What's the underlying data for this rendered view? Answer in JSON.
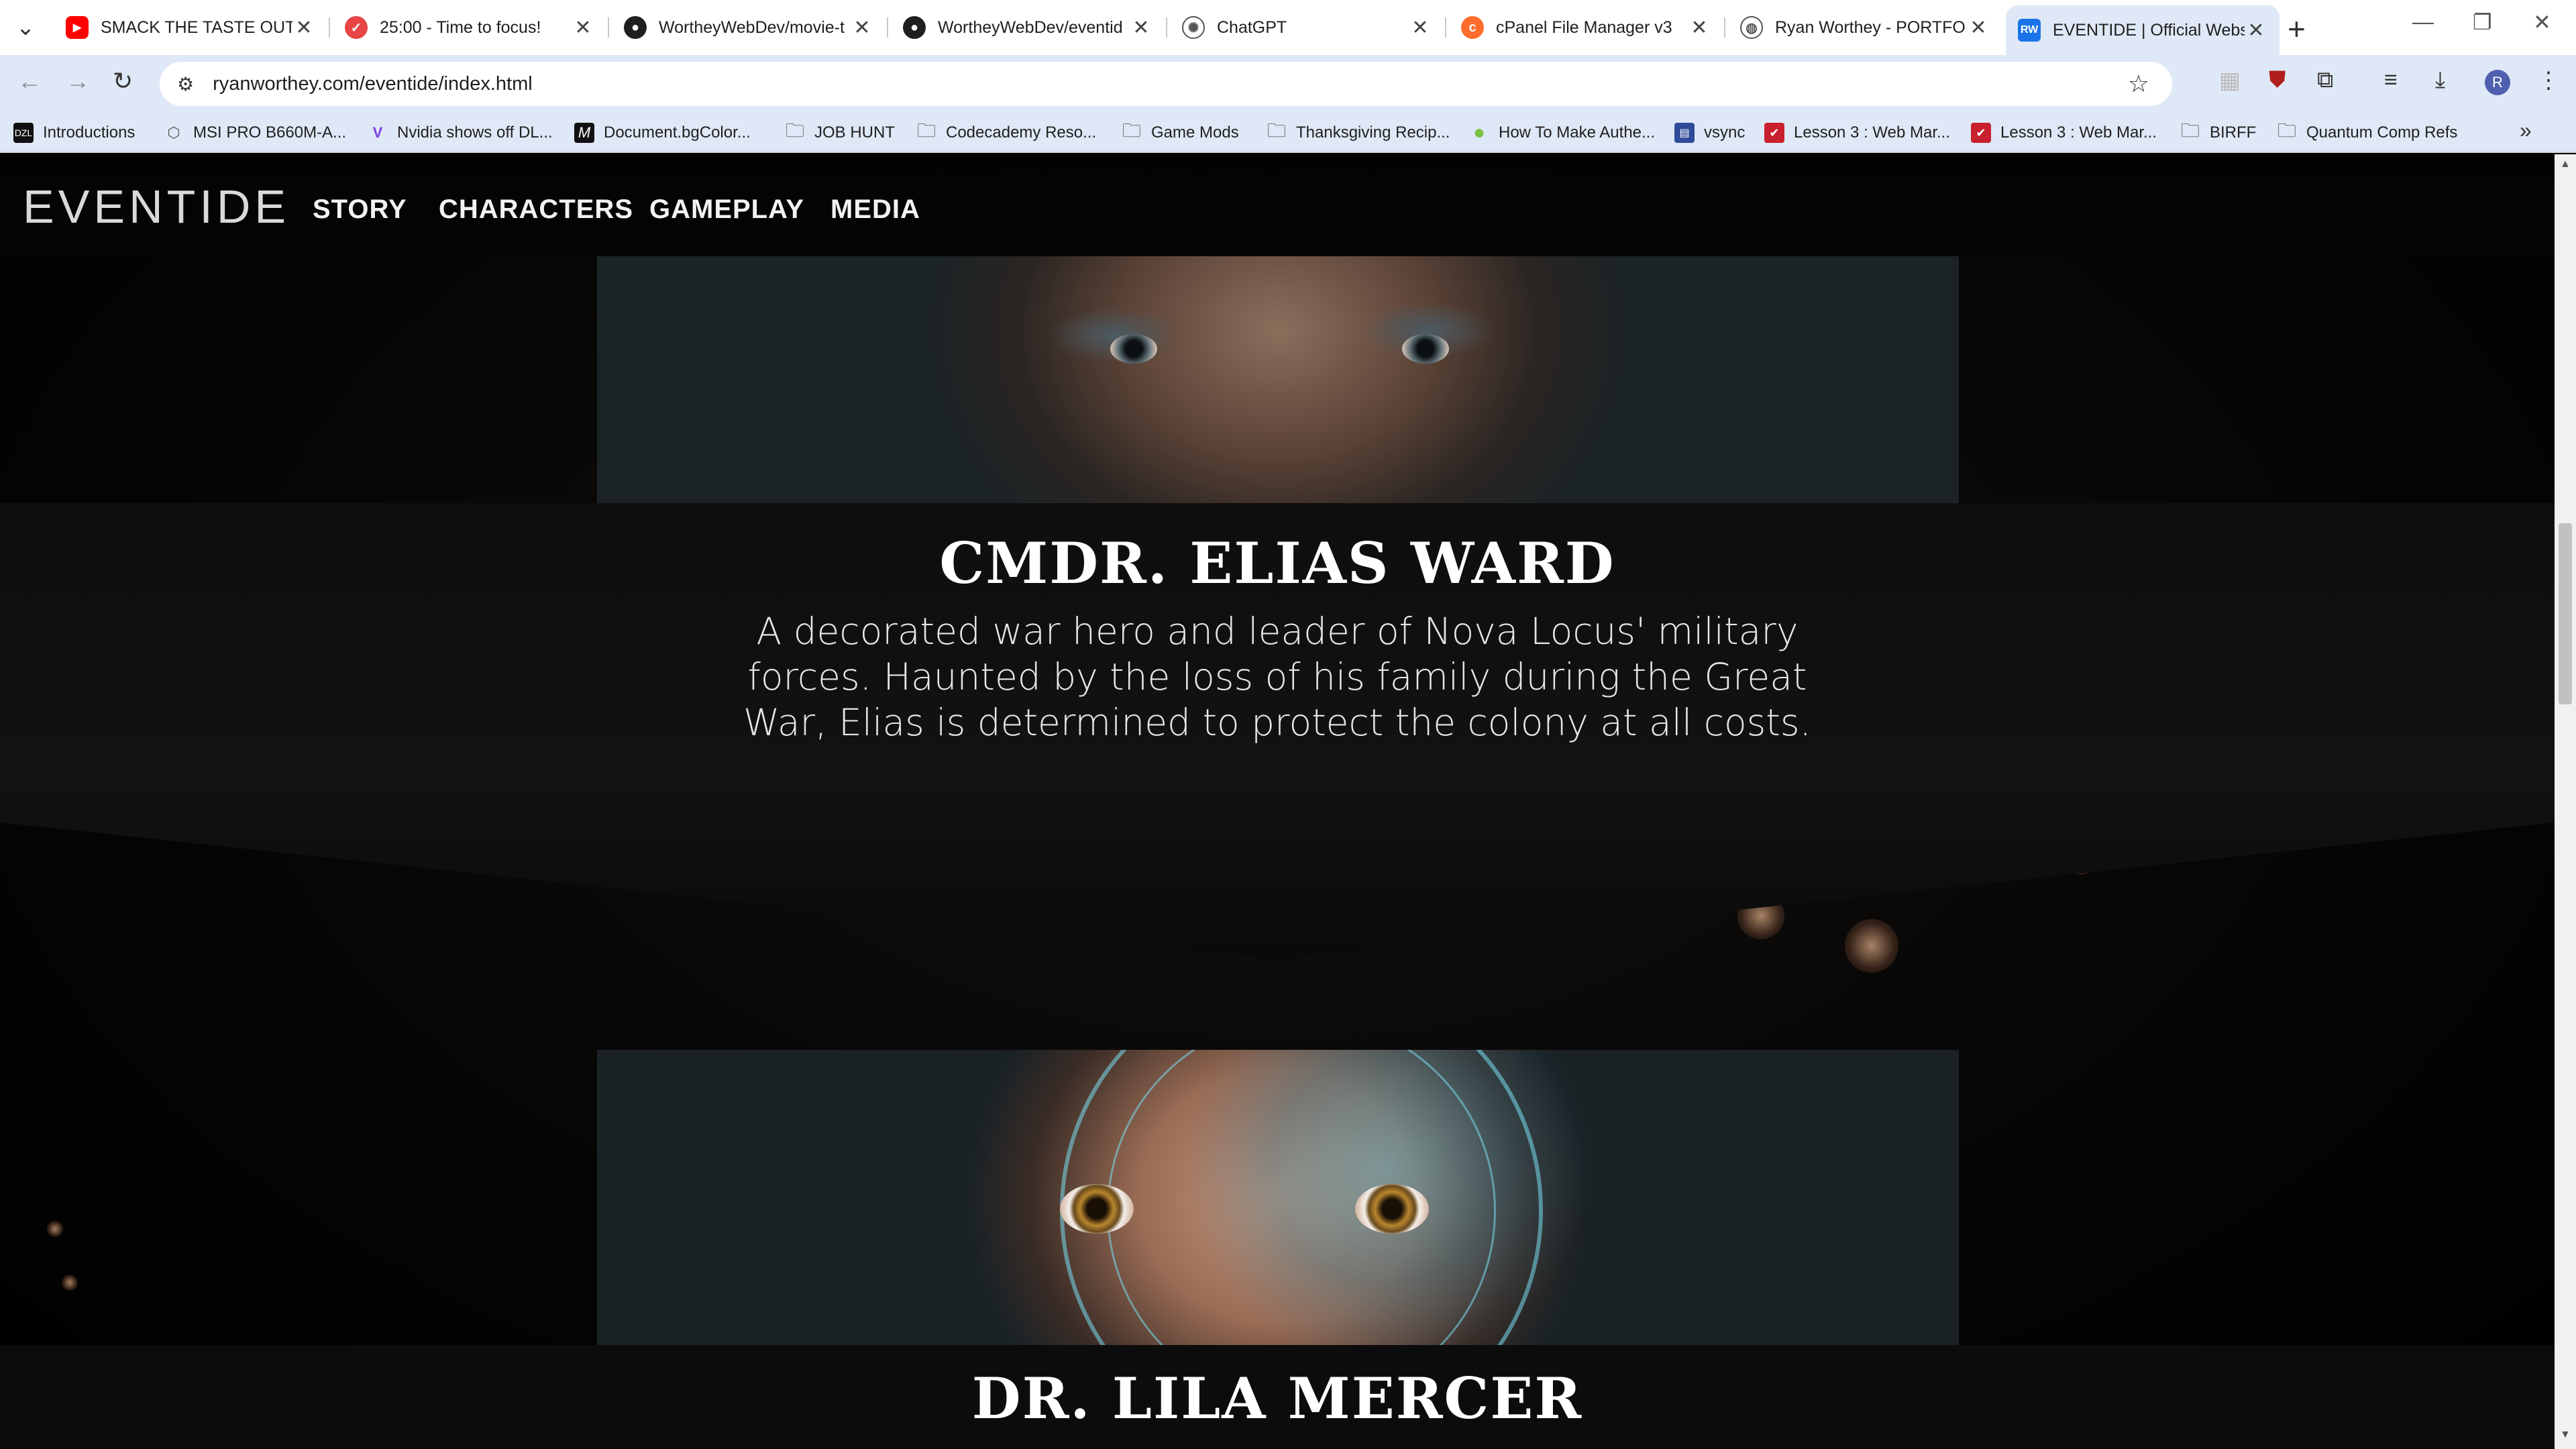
{
  "browser": {
    "tabs": [
      {
        "title": "SMACK THE TASTE OUT Y",
        "icon": "youtube-icon",
        "color": "#ff0000",
        "glyph": "▶"
      },
      {
        "title": "25:00 - Time to focus!",
        "icon": "pomofocus-icon",
        "color": "#e84545",
        "glyph": "✓"
      },
      {
        "title": "WortheyWebDev/movie-t",
        "icon": "github-icon",
        "color": "#1f1f1f",
        "glyph": "●"
      },
      {
        "title": "WortheyWebDev/eventid",
        "icon": "github-icon",
        "color": "#1f1f1f",
        "glyph": "●"
      },
      {
        "title": "ChatGPT",
        "icon": "chatgpt-icon",
        "color": "#555555",
        "glyph": "✺"
      },
      {
        "title": "cPanel File Manager v3",
        "icon": "cpanel-icon",
        "color": "#ff6c2c",
        "glyph": "c"
      },
      {
        "title": "Ryan Worthey - PORTFOL",
        "icon": "globe-icon",
        "color": "#555555",
        "glyph": "◍"
      },
      {
        "title": "EVENTIDE | Official Websi",
        "icon": "rw-icon",
        "color": "#1a73e8",
        "glyph": "RW"
      }
    ],
    "url": "ryanworthey.com/eventide/index.html",
    "profile_initial": "R",
    "bookmarks": [
      {
        "label": "Introductions",
        "icon": "dzl-icon"
      },
      {
        "label": "MSI PRO B660M-A...",
        "icon": "msi-icon"
      },
      {
        "label": "Nvidia shows off DL...",
        "icon": "nvidia-icon"
      },
      {
        "label": "Document.bgColor...",
        "icon": "mdn-icon"
      },
      {
        "label": "JOB HUNT",
        "icon": "folder-icon"
      },
      {
        "label": "Codecademy Reso...",
        "icon": "folder-icon"
      },
      {
        "label": "Game Mods",
        "icon": "folder-icon"
      },
      {
        "label": "Thanksgiving Recip...",
        "icon": "folder-icon"
      },
      {
        "label": "How To Make Authe...",
        "icon": "green-dot-icon"
      },
      {
        "label": "vsync",
        "icon": "page-icon"
      },
      {
        "label": "Lesson 3 : Web Mar...",
        "icon": "lesson-icon"
      },
      {
        "label": "Lesson 3 : Web Mar...",
        "icon": "lesson-icon"
      },
      {
        "label": "BIRFF",
        "icon": "folder-icon"
      },
      {
        "label": "Quantum Comp Refs",
        "icon": "folder-icon"
      }
    ]
  },
  "site": {
    "logo": "EVENTIDE",
    "nav": [
      "STORY",
      "CHARACTERS",
      "GAMEPLAY",
      "MEDIA"
    ],
    "characters": [
      {
        "name": "CMDR. ELIAS WARD",
        "description": "A decorated war hero and leader of Nova Locus' military forces. Haunted by the loss of his family during the Great War, Elias is determined to protect the colony at all costs."
      },
      {
        "name": "DR. LILA MERCER"
      }
    ]
  }
}
